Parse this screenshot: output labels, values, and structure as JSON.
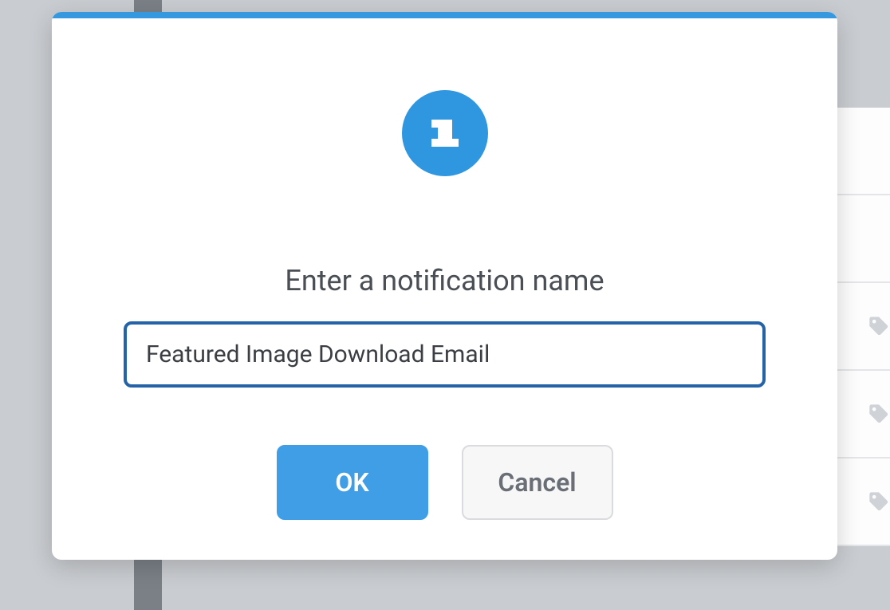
{
  "dialog": {
    "prompt": "Enter a notification name",
    "input_value": "Featured Image Download Email",
    "ok_label": "OK",
    "cancel_label": "Cancel"
  },
  "colors": {
    "accent": "#3f9ee5",
    "info_circle": "#2f97e0",
    "input_border": "#2563a8",
    "top_bar": "#3699e0"
  }
}
